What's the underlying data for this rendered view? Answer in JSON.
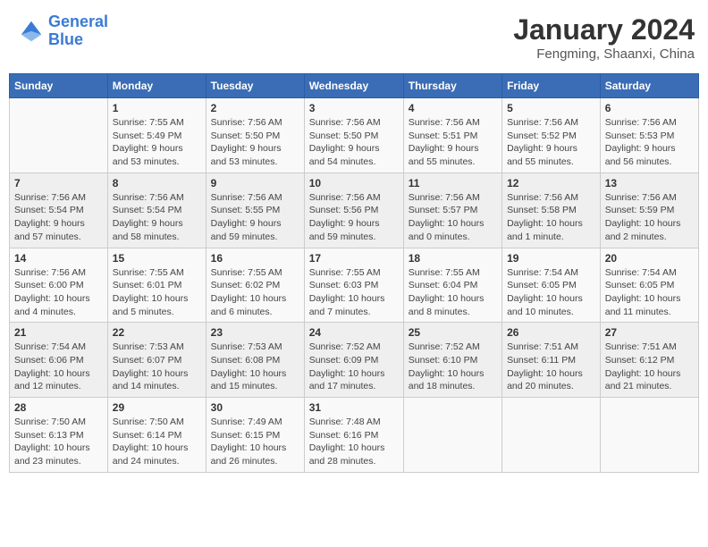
{
  "header": {
    "logo_line1": "General",
    "logo_line2": "Blue",
    "month": "January 2024",
    "location": "Fengming, Shaanxi, China"
  },
  "days_of_week": [
    "Sunday",
    "Monday",
    "Tuesday",
    "Wednesday",
    "Thursday",
    "Friday",
    "Saturday"
  ],
  "weeks": [
    [
      {
        "day": "",
        "info": ""
      },
      {
        "day": "1",
        "info": "Sunrise: 7:55 AM\nSunset: 5:49 PM\nDaylight: 9 hours\nand 53 minutes."
      },
      {
        "day": "2",
        "info": "Sunrise: 7:56 AM\nSunset: 5:50 PM\nDaylight: 9 hours\nand 53 minutes."
      },
      {
        "day": "3",
        "info": "Sunrise: 7:56 AM\nSunset: 5:50 PM\nDaylight: 9 hours\nand 54 minutes."
      },
      {
        "day": "4",
        "info": "Sunrise: 7:56 AM\nSunset: 5:51 PM\nDaylight: 9 hours\nand 55 minutes."
      },
      {
        "day": "5",
        "info": "Sunrise: 7:56 AM\nSunset: 5:52 PM\nDaylight: 9 hours\nand 55 minutes."
      },
      {
        "day": "6",
        "info": "Sunrise: 7:56 AM\nSunset: 5:53 PM\nDaylight: 9 hours\nand 56 minutes."
      }
    ],
    [
      {
        "day": "7",
        "info": "Sunrise: 7:56 AM\nSunset: 5:54 PM\nDaylight: 9 hours\nand 57 minutes."
      },
      {
        "day": "8",
        "info": "Sunrise: 7:56 AM\nSunset: 5:54 PM\nDaylight: 9 hours\nand 58 minutes."
      },
      {
        "day": "9",
        "info": "Sunrise: 7:56 AM\nSunset: 5:55 PM\nDaylight: 9 hours\nand 59 minutes."
      },
      {
        "day": "10",
        "info": "Sunrise: 7:56 AM\nSunset: 5:56 PM\nDaylight: 9 hours\nand 59 minutes."
      },
      {
        "day": "11",
        "info": "Sunrise: 7:56 AM\nSunset: 5:57 PM\nDaylight: 10 hours\nand 0 minutes."
      },
      {
        "day": "12",
        "info": "Sunrise: 7:56 AM\nSunset: 5:58 PM\nDaylight: 10 hours\nand 1 minute."
      },
      {
        "day": "13",
        "info": "Sunrise: 7:56 AM\nSunset: 5:59 PM\nDaylight: 10 hours\nand 2 minutes."
      }
    ],
    [
      {
        "day": "14",
        "info": "Sunrise: 7:56 AM\nSunset: 6:00 PM\nDaylight: 10 hours\nand 4 minutes."
      },
      {
        "day": "15",
        "info": "Sunrise: 7:55 AM\nSunset: 6:01 PM\nDaylight: 10 hours\nand 5 minutes."
      },
      {
        "day": "16",
        "info": "Sunrise: 7:55 AM\nSunset: 6:02 PM\nDaylight: 10 hours\nand 6 minutes."
      },
      {
        "day": "17",
        "info": "Sunrise: 7:55 AM\nSunset: 6:03 PM\nDaylight: 10 hours\nand 7 minutes."
      },
      {
        "day": "18",
        "info": "Sunrise: 7:55 AM\nSunset: 6:04 PM\nDaylight: 10 hours\nand 8 minutes."
      },
      {
        "day": "19",
        "info": "Sunrise: 7:54 AM\nSunset: 6:05 PM\nDaylight: 10 hours\nand 10 minutes."
      },
      {
        "day": "20",
        "info": "Sunrise: 7:54 AM\nSunset: 6:05 PM\nDaylight: 10 hours\nand 11 minutes."
      }
    ],
    [
      {
        "day": "21",
        "info": "Sunrise: 7:54 AM\nSunset: 6:06 PM\nDaylight: 10 hours\nand 12 minutes."
      },
      {
        "day": "22",
        "info": "Sunrise: 7:53 AM\nSunset: 6:07 PM\nDaylight: 10 hours\nand 14 minutes."
      },
      {
        "day": "23",
        "info": "Sunrise: 7:53 AM\nSunset: 6:08 PM\nDaylight: 10 hours\nand 15 minutes."
      },
      {
        "day": "24",
        "info": "Sunrise: 7:52 AM\nSunset: 6:09 PM\nDaylight: 10 hours\nand 17 minutes."
      },
      {
        "day": "25",
        "info": "Sunrise: 7:52 AM\nSunset: 6:10 PM\nDaylight: 10 hours\nand 18 minutes."
      },
      {
        "day": "26",
        "info": "Sunrise: 7:51 AM\nSunset: 6:11 PM\nDaylight: 10 hours\nand 20 minutes."
      },
      {
        "day": "27",
        "info": "Sunrise: 7:51 AM\nSunset: 6:12 PM\nDaylight: 10 hours\nand 21 minutes."
      }
    ],
    [
      {
        "day": "28",
        "info": "Sunrise: 7:50 AM\nSunset: 6:13 PM\nDaylight: 10 hours\nand 23 minutes."
      },
      {
        "day": "29",
        "info": "Sunrise: 7:50 AM\nSunset: 6:14 PM\nDaylight: 10 hours\nand 24 minutes."
      },
      {
        "day": "30",
        "info": "Sunrise: 7:49 AM\nSunset: 6:15 PM\nDaylight: 10 hours\nand 26 minutes."
      },
      {
        "day": "31",
        "info": "Sunrise: 7:48 AM\nSunset: 6:16 PM\nDaylight: 10 hours\nand 28 minutes."
      },
      {
        "day": "",
        "info": ""
      },
      {
        "day": "",
        "info": ""
      },
      {
        "day": "",
        "info": ""
      }
    ]
  ]
}
